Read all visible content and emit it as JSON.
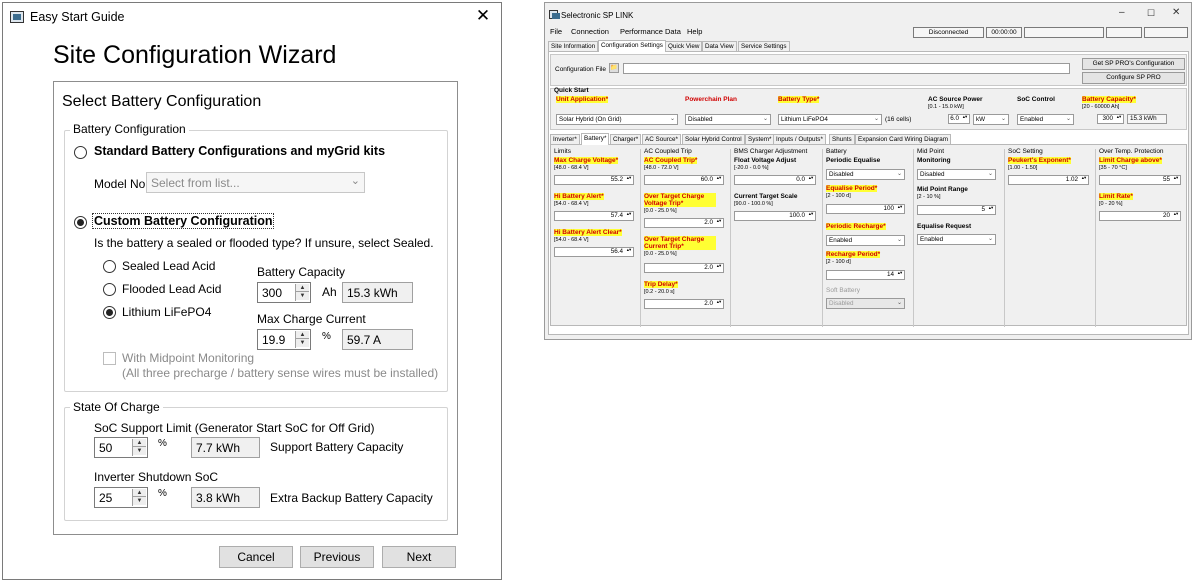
{
  "left_window": {
    "title": "Easy Start Guide",
    "close_glyph": "✕",
    "wizard_title": "Site Configuration Wizard",
    "panel_title": "Select Battery Configuration",
    "battery_config": {
      "group_label": "Battery Configuration",
      "standard_option": "Standard Battery Configurations and myGrid kits",
      "model_label": "Model No",
      "model_placeholder": "Select from list...",
      "custom_option": "Custom Battery Configuration",
      "question": "Is the battery a sealed or flooded type? If unsure, select Sealed.",
      "types": [
        "Sealed Lead Acid",
        "Flooded Lead Acid",
        "Lithium LiFePO4"
      ],
      "selected_type": "Lithium LiFePO4",
      "capacity_label": "Battery Capacity",
      "capacity_value": "300",
      "capacity_unit": "Ah",
      "capacity_kwh": "15.3 kWh",
      "max_charge_label": "Max Charge Current",
      "max_charge_value": "19.9",
      "max_charge_unit": "%",
      "max_charge_amps": "59.7 A",
      "midpoint_label": "With Midpoint Monitoring",
      "midpoint_note": "(All three precharge / battery sense wires must be installed)"
    },
    "soc": {
      "group_label": "State Of Charge",
      "support_label": "SoC Support Limit (Generator Start SoC for Off Grid)",
      "support_value": "50",
      "support_unit": "%",
      "support_kwh": "7.7 kWh",
      "support_desc": "Support Battery Capacity",
      "shutdown_label": "Inverter Shutdown SoC",
      "shutdown_value": "25",
      "shutdown_unit": "%",
      "shutdown_kwh": "3.8 kWh",
      "shutdown_desc": "Extra Backup Battery Capacity"
    },
    "buttons": {
      "cancel": "Cancel",
      "previous": "Previous",
      "next": "Next"
    }
  },
  "right_window": {
    "title": "Selectronic SP LINK",
    "window_controls": {
      "minimize": "–",
      "maximize": "☐",
      "close": "✕"
    },
    "menu": [
      "File",
      "Connection",
      "Performance Data",
      "Help"
    ],
    "status": {
      "connection": "Disconnected",
      "time": "00:00:00"
    },
    "main_tabs": [
      "Site Information",
      "Configuration Settings",
      "Quick View",
      "Data View",
      "Service Settings"
    ],
    "config_file_label": "Configuration File",
    "buttons": {
      "get_config": "Get SP PRO's Configuration",
      "configure": "Configure SP PRO"
    },
    "quick_start": {
      "label": "Quick Start",
      "unit_application_label": "Unit Application*",
      "unit_application_value": "Solar Hybrid (On Grid)",
      "powerchain_label": "Powerchain Plan",
      "powerchain_value": "Disabled",
      "battery_type_label": "Battery Type*",
      "battery_type_value": "Lithium LiFePO4",
      "cells": "(16 cells)",
      "ac_source_label": "AC Source Power",
      "ac_source_range": "[0.1 - 15.0 kW]",
      "ac_source_value": "6.0",
      "ac_source_unit": "kW",
      "soc_control_label": "SoC Control",
      "soc_control_value": "Enabled",
      "battery_capacity_label": "Battery Capacity*",
      "battery_capacity_range": "[20 - 60000 Ah]",
      "battery_capacity_value": "300",
      "battery_capacity_kwh": "15.3 kWh"
    },
    "sub_tabs": [
      "Inverter*",
      "Battery*",
      "Charger*",
      "AC Source*",
      "Solar Hybrid Control",
      "System*",
      "Inputs / Outputs*",
      "Shunts",
      "Expansion Card Wiring Diagram"
    ],
    "limits": {
      "title": "Limits",
      "max_charge_label": "Max Charge Voltage*",
      "max_charge_range": "[48.0 - 68.4 V]",
      "max_charge_value": "55.2",
      "hi_alert_label": "Hi Battery Alert*",
      "hi_alert_range": "[54.0 - 68.4 V]",
      "hi_alert_value": "57.4",
      "hi_clear_label": "Hi Battery Alert Clear*",
      "hi_clear_range": "[54.0 - 68.4 V]",
      "hi_clear_value": "56.4"
    },
    "ac_coupled": {
      "title": "AC Coupled Trip",
      "trip_label": "AC Coupled Trip*",
      "trip_range": "[48.0 - 72.0 V]",
      "trip_value": "60.0",
      "ot_voltage_label": "Over Target Charge Voltage Trip*",
      "ot_voltage_range": "[0.0 - 25.0 %]",
      "ot_voltage_value": "2.0",
      "ot_current_label": "Over Target Charge Current Trip*",
      "ot_current_range": "[0.0 - 25.0 %]",
      "ot_current_value": "2.0",
      "delay_label": "Trip Delay*",
      "delay_range": "[0.2 - 20.0 s]",
      "delay_value": "2.0"
    },
    "bms": {
      "title": "BMS Charger Adjustment",
      "float_label": "Float Voltage Adjust",
      "float_range": "[-20.0 - 0.0 %]",
      "float_value": "0.0",
      "target_label": "Current Target Scale",
      "target_range": "[90.0 - 100.0 %]",
      "target_value": "100.0"
    },
    "battery": {
      "title": "Battery",
      "periodic_label": "Periodic Equalise",
      "periodic_value": "Disabled",
      "eq_period_label": "Equalise Period*",
      "eq_period_range": "[2 - 100 d]",
      "eq_period_value": "100",
      "recharge_label": "Periodic Recharge*",
      "recharge_value": "Enabled",
      "recharge_period_label": "Recharge Period*",
      "recharge_period_range": "[2 - 100 d]",
      "recharge_period_value": "14",
      "soft_label": "Soft Battery",
      "soft_value": "Disabled"
    },
    "midpoint": {
      "title": "Mid Point",
      "monitoring_label": "Monitoring",
      "monitoring_value": "Disabled",
      "range_label": "Mid Point Range",
      "range_range": "[2 - 10 %]",
      "range_value": "5",
      "eq_request_label": "Equalise Request",
      "eq_request_value": "Enabled"
    },
    "soc_setting": {
      "title": "SoC Setting",
      "peukert_label": "Peukert's Exponent*",
      "peukert_range": "[1.00 - 1.50]",
      "peukert_value": "1.02"
    },
    "over_temp": {
      "title": "Over Temp. Protection",
      "limit_label": "Limit Charge above*",
      "limit_range": "[35 - 70 °C]",
      "limit_value": "55",
      "rate_label": "Limit Rate*",
      "rate_range": "[0 - 20 %]",
      "rate_value": "20"
    }
  }
}
